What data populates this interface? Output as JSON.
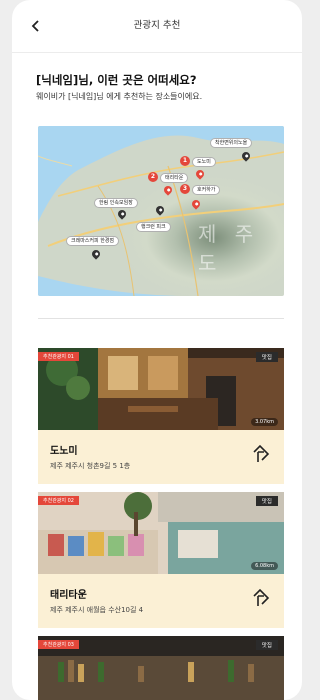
{
  "header": {
    "title": "관광지 추천",
    "back_icon": "chevron-left-icon"
  },
  "greeting": {
    "title": "[닉네임]님, 이런 곳은 어떠세요?",
    "subtitle": "웨이비가 [닉네임]님 에게 추천하는 장소들이에요."
  },
  "map": {
    "region_label": "제 주 도",
    "markers": [
      {
        "label": "착한면위의노을"
      },
      {
        "label": "도노미",
        "number": "1"
      },
      {
        "label": "태리타운",
        "number": "2"
      },
      {
        "label": "호커하가",
        "number": "3"
      },
      {
        "label": "한림 인속모임장"
      },
      {
        "label": "행크런 피크"
      },
      {
        "label": "크레마스커피 한경점"
      }
    ]
  },
  "places": [
    {
      "badge": "추천관광지 01",
      "category": "맛집",
      "distance": "3.07km",
      "name": "도노미",
      "address": "제주 제주시 청촌9길 5 1층",
      "photo_colors": [
        "#3a2a1e",
        "#6e4a2e",
        "#a3763f",
        "#2d4a2a"
      ]
    },
    {
      "badge": "추천관광지 02",
      "category": "맛집",
      "distance": "6.08km",
      "name": "태리타운",
      "address": "제주 제주시 애월읍 수산10길 4",
      "photo_colors": [
        "#7aa59e",
        "#c9c3b6",
        "#e0d3c3",
        "#4c6e3a"
      ]
    },
    {
      "badge": "추천관광지 03",
      "category": "맛집",
      "distance": "",
      "name": "",
      "address": "",
      "photo_colors": [
        "#2a2622",
        "#5a4a38",
        "#8b6b45",
        "#3d6a2e"
      ]
    }
  ],
  "colors": {
    "accent": "#e4473a",
    "card_info_bg": "#fbf0d5",
    "badge_dark": "#2b2b2b"
  }
}
